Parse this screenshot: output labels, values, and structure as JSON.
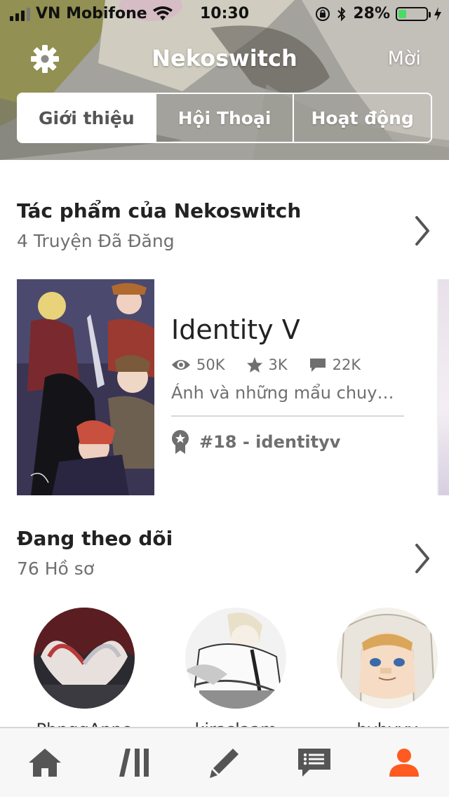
{
  "status_bar": {
    "carrier": "VN Mobifone",
    "time": "10:30",
    "battery": "28%",
    "battery_level": 0.28
  },
  "header": {
    "title": "Nekoswitch",
    "invite_label": "Mời",
    "settings_icon": "gear-icon",
    "tabs": [
      {
        "label": "Giới thiệu",
        "active": true
      },
      {
        "label": "Hội Thoại",
        "active": false
      },
      {
        "label": "Hoạt động",
        "active": false
      }
    ]
  },
  "works": {
    "title": "Tác phẩm của Nekoswitch",
    "subtitle": "4 Truyện Đã Đăng",
    "stories": [
      {
        "title": "Identity V",
        "reads": "50K",
        "votes": "3K",
        "comments": "22K",
        "description": "Ảnh và những mẩu chuyện nhỏ",
        "rank": "#18 - identityv"
      }
    ]
  },
  "following": {
    "title": "Đang theo dõi",
    "subtitle": "76 Hồ sơ",
    "profiles": [
      {
        "name": "PhnggAnne"
      },
      {
        "name": "kiraslaam"
      },
      {
        "name": "hyhyyy"
      }
    ]
  },
  "tabbar": {
    "items": [
      "home-icon",
      "library-icon",
      "write-icon",
      "messages-icon",
      "profile-icon"
    ],
    "active_color": "#ff5a1f",
    "inactive_color": "#555555"
  },
  "colors": {
    "accent": "#ff5a1f",
    "battery": "#4cd964"
  }
}
